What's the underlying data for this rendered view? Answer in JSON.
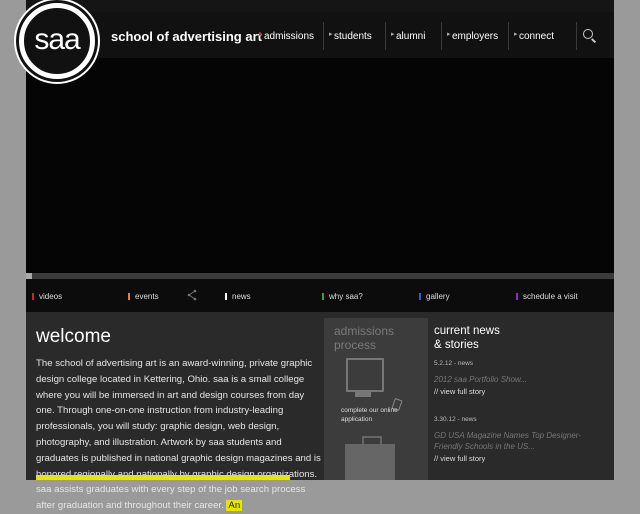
{
  "brand": {
    "logo_text": "saa",
    "school_name": "school of advertising art"
  },
  "nav": {
    "items": [
      "admissions",
      "students",
      "alumni",
      "employers",
      "connect"
    ]
  },
  "tabs": [
    {
      "label": "videos",
      "color": "#d01f2e"
    },
    {
      "label": "events",
      "color": "#f07a2a"
    },
    {
      "label": "news",
      "color": "#ffffff"
    },
    {
      "label": "why saa?",
      "color": "#2aa63a"
    },
    {
      "label": "gallery",
      "color": "#2e5fd0"
    },
    {
      "label": "schedule a visit",
      "color": "#8a2ad0"
    }
  ],
  "welcome": {
    "title": "welcome",
    "body": "The school of advertising art is an award-winning, private graphic design college located in Kettering, Ohio. saa is a small college where you will be immersed in art and design courses from day one. Through one-on-one instruction from industry-leading professionals, you will study: graphic design, web design, photography, and illustration. Artwork by saa students and graduates is published in national graphic design magazines and is honored regionally and nationally by graphic design organizations. saa assists graduates with every step of the job search process after graduation and throughout their career.",
    "highlight": "An"
  },
  "admissions": {
    "title_line1": "admissions",
    "title_line2": "process",
    "caption": "complete our online application"
  },
  "news": {
    "title_line1": "current news",
    "title_line2": "& stories",
    "items": [
      {
        "date": "5.2.12 - news",
        "headline": "2012 saa Portfolio Show...",
        "link": "// view full story"
      },
      {
        "date": "3.30.12 - news",
        "headline": "GD USA Magazine Names Top Designer-Friendly Schools in the US...",
        "link": "// view full story"
      }
    ]
  },
  "colors": {
    "accent_red": "#d01f2e",
    "highlight_yellow": "#e6e600"
  }
}
